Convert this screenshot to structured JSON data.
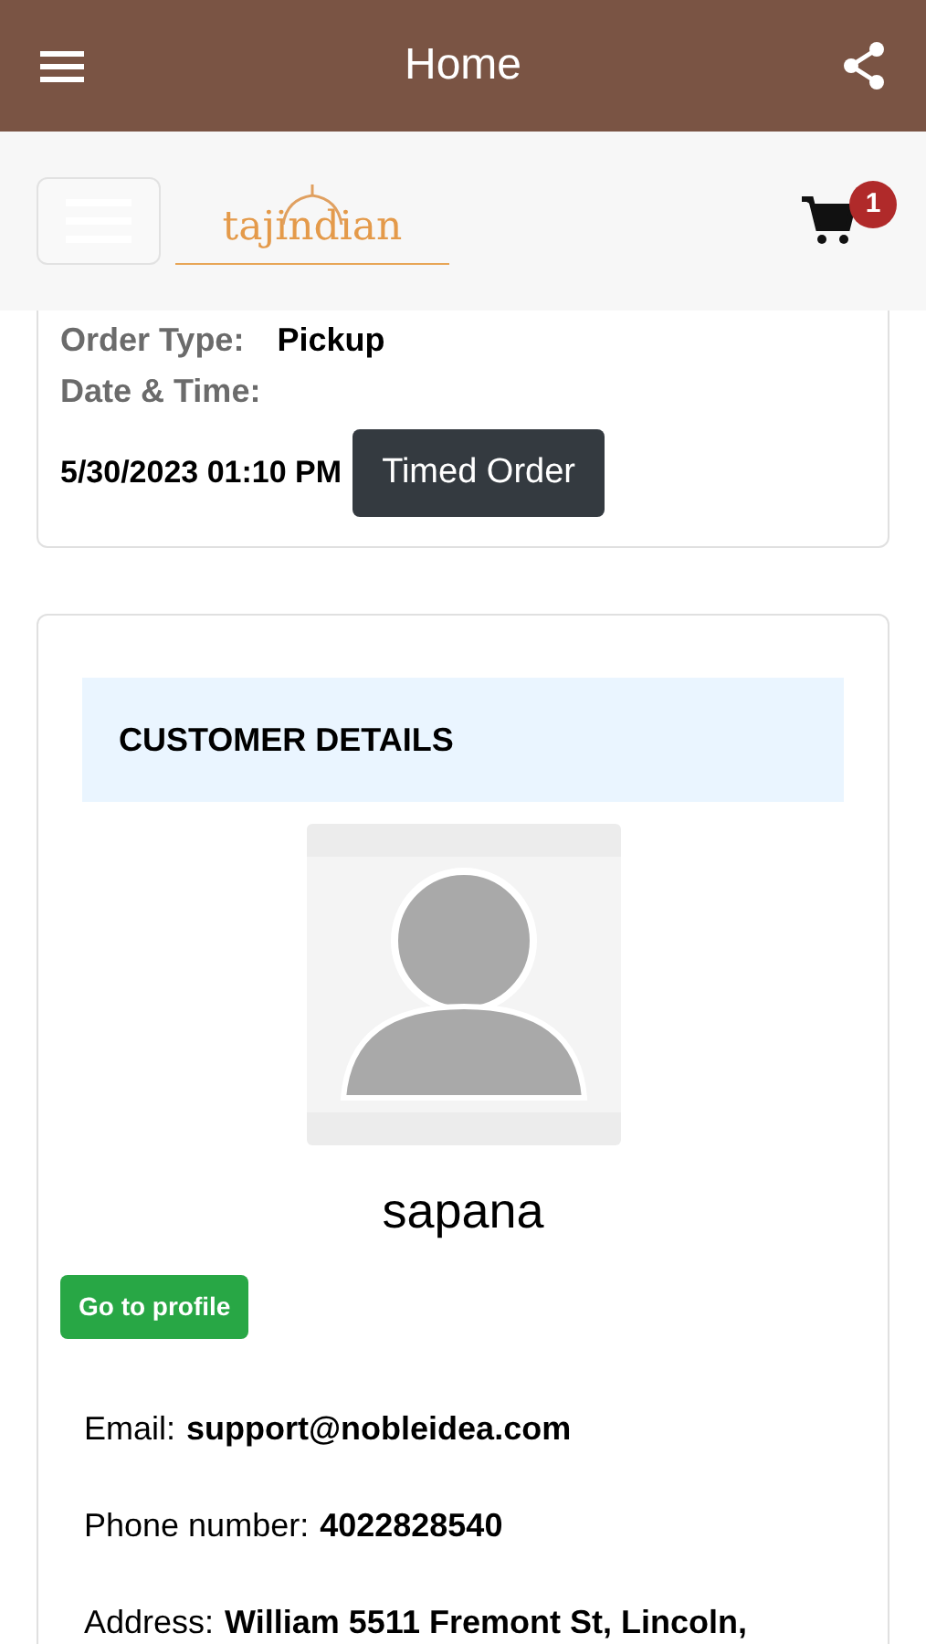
{
  "app_bar": {
    "title": "Home"
  },
  "header": {
    "logo": "tajindian",
    "cart_count": "1"
  },
  "order": {
    "type_label": "Order Type:",
    "type_value": "Pickup",
    "date_label": "Date & Time:",
    "date_value": "5/30/2023 01:10 PM",
    "badge": "Timed Order"
  },
  "customer": {
    "heading": "CUSTOMER DETAILS",
    "name": "sapana",
    "profile_button": "Go to profile",
    "fields": [
      {
        "label": "Email:",
        "value": "support@nobleidea.com"
      },
      {
        "label": "Phone number:",
        "value": "4022828540"
      },
      {
        "label": "Address:",
        "value": "William 5511 Fremont St, Lincoln,"
      }
    ]
  }
}
